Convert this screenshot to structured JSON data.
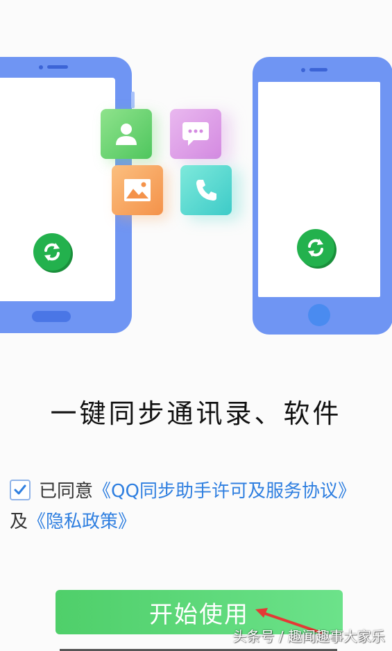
{
  "illustration": {
    "icons": [
      "contact-icon",
      "message-icon",
      "photo-icon",
      "phone-icon",
      "sync-icon"
    ]
  },
  "headline": "一键同步通讯录、软件",
  "agreement": {
    "prefix": "已同意",
    "license_link": "《QQ同步助手许可及服务协议》",
    "conjunction": "及",
    "privacy_link": "《隐私政策》",
    "checked": true
  },
  "start_button": {
    "label": "开始使用"
  },
  "watermark": "头条号 / 趣闻趣事大家乐",
  "colors": {
    "primary_green": "#4fcf6a",
    "link_blue": "#2f7fe0",
    "phone_blue": "#6f95f3"
  }
}
